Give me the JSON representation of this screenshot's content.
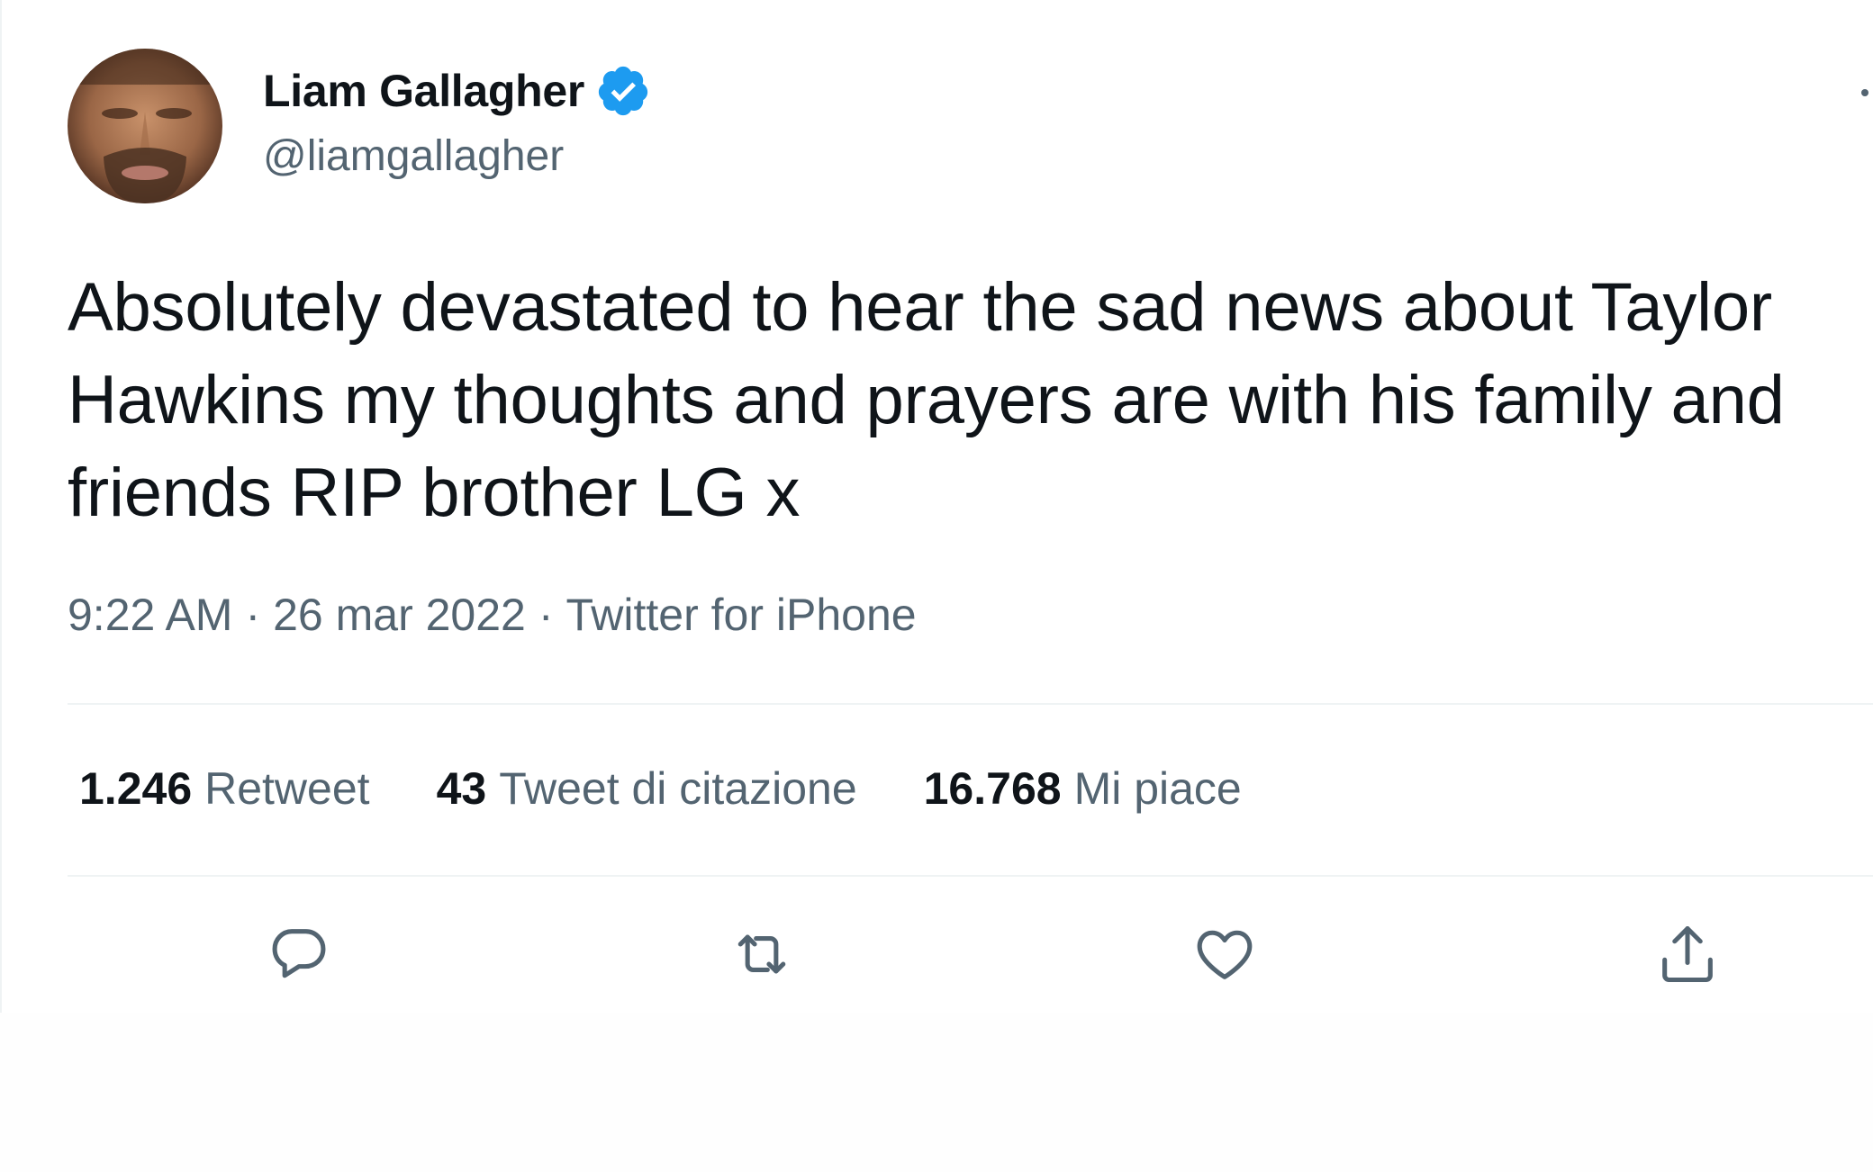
{
  "author": {
    "display_name": "Liam Gallagher",
    "handle": "@liamgallagher",
    "verified": true
  },
  "tweet": {
    "text": "Absolutely devastated to hear the sad news about Taylor Hawkins my thoughts and prayers are with his family and friends RIP brother LG x",
    "time": "9:22 AM",
    "date": "26 mar 2022",
    "source": "Twitter for iPhone",
    "separator": "·"
  },
  "stats": {
    "retweets_count": "1.246",
    "retweets_label": "Retweet",
    "quotes_count": "43",
    "quotes_label": "Tweet di citazione",
    "likes_count": "16.768",
    "likes_label": "Mi piace"
  },
  "actions": [
    {
      "icon": "reply-icon"
    },
    {
      "icon": "retweet-icon"
    },
    {
      "icon": "like-icon"
    },
    {
      "icon": "share-icon"
    }
  ],
  "colors": {
    "text_primary": "#0f1419",
    "text_secondary": "#536471",
    "verified_blue": "#1d9bf0",
    "divider": "#eff3f4"
  }
}
